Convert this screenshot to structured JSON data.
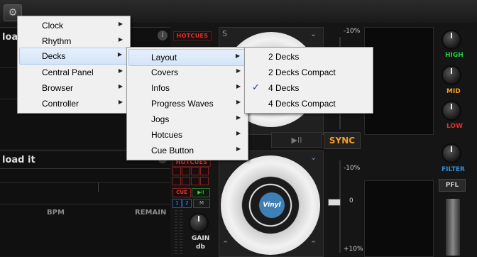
{
  "deck_top": {
    "title": "loa",
    "hotcues_label": "HOTCUES"
  },
  "deck_bottom": {
    "title": "load it",
    "bpm_label": "BPM",
    "remain_label": "REMAIN",
    "hotcues_label": "HOTCUES",
    "cue_label": "CUE",
    "play_label": "▶II",
    "num1": "1",
    "num2": "2",
    "m_label": "M"
  },
  "gain": {
    "label": "GAIN",
    "unit": "db"
  },
  "pitch": {
    "top_pct": "-10%",
    "bottom_pct": "+10%",
    "mid_value": "0"
  },
  "sync_label": "SYNC",
  "eq": {
    "high": "HIGH",
    "mid": "MID",
    "low": "LOW",
    "filter": "FILTER"
  },
  "pfl_label": "PFL",
  "platter_logo": "Vinyl",
  "colors": {
    "high": "#1fcf3a",
    "mid": "#f59d27",
    "low": "#e5302a",
    "filter": "#2f8fe0",
    "sync": "#f59d27",
    "hotcue": "#e0342a"
  },
  "menu_main": {
    "items": [
      {
        "label": "Clock"
      },
      {
        "label": "Rhythm"
      },
      {
        "label": "Decks",
        "highlighted": true
      },
      {
        "label": "Central Panel"
      },
      {
        "label": "Browser"
      },
      {
        "label": "Controller"
      }
    ]
  },
  "menu_decks": {
    "items": [
      {
        "label": "Layout",
        "highlighted": true
      },
      {
        "label": "Covers"
      },
      {
        "label": "Infos"
      },
      {
        "label": "Progress Waves"
      },
      {
        "label": "Jogs"
      },
      {
        "label": "Hotcues"
      },
      {
        "label": "Cue Button"
      }
    ]
  },
  "menu_layout": {
    "items": [
      {
        "label": "2 Decks"
      },
      {
        "label": "2 Decks Compact"
      },
      {
        "label": "4 Decks",
        "checked": true
      },
      {
        "label": "4 Decks Compact"
      }
    ]
  },
  "icons": {
    "gear": "gear-icon",
    "submenu": "submenu-arrow-icon",
    "check": "checkmark-icon",
    "info": "info-icon"
  }
}
